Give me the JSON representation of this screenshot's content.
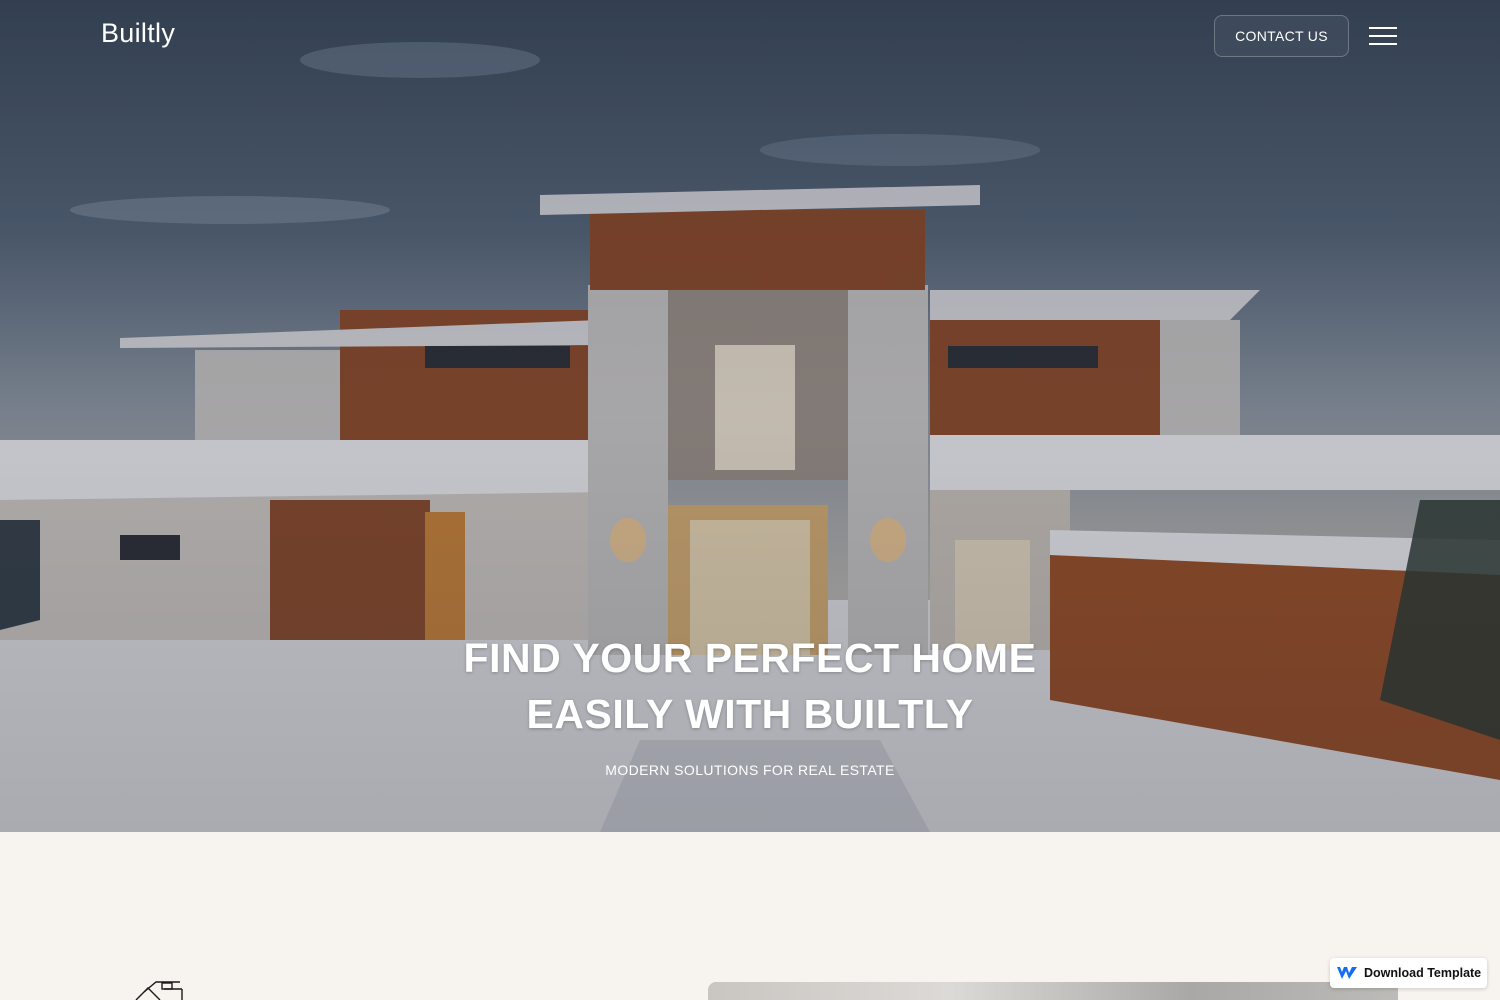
{
  "nav": {
    "logo": "Builtly",
    "contact_label": "CONTACT US"
  },
  "hero": {
    "title_line1": "FIND YOUR PERFECT HOME",
    "title_line2": "EASILY WITH BUILTLY",
    "subtitle": "MODERN SOLUTIONS FOR REAL ESTATE"
  },
  "badge": {
    "label": "Download Template"
  },
  "icons": [
    "menu-icon",
    "house-icon",
    "webflow-icon"
  ]
}
